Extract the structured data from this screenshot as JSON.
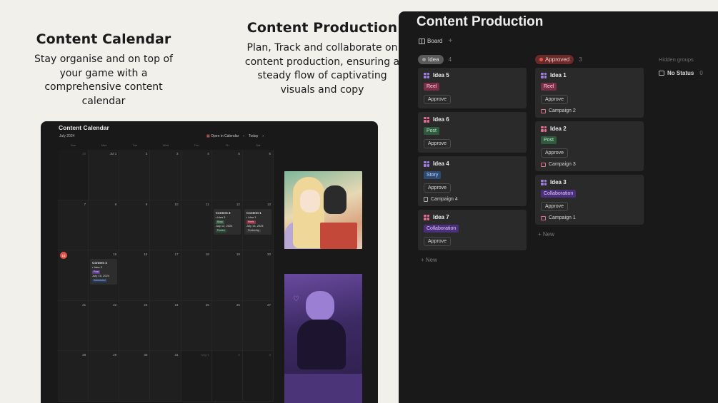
{
  "promo_calendar": {
    "title": "Content Calendar",
    "text": "Stay organise and on top of your game with a comprehensive content calendar"
  },
  "promo_production": {
    "title": "Content Production",
    "text": "Plan, Track and collaborate on content production, ensuring a steady flow of captivating visuals and copy"
  },
  "calendar": {
    "title": "Content Calendar",
    "month": "July 2024",
    "open_label": "Open in Calendar",
    "today_label": "Today",
    "weekdays": [
      "Sun",
      "Mon",
      "Tue",
      "Wed",
      "Thu",
      "Fri",
      "Sat"
    ],
    "days": [
      {
        "n": "30",
        "out": true
      },
      {
        "n": "Jul 1"
      },
      {
        "n": "2"
      },
      {
        "n": "3"
      },
      {
        "n": "4"
      },
      {
        "n": "5"
      },
      {
        "n": "6"
      },
      {
        "n": "7"
      },
      {
        "n": "8"
      },
      {
        "n": "9"
      },
      {
        "n": "10"
      },
      {
        "n": "11"
      },
      {
        "n": "12",
        "event": {
          "title": "Content 3",
          "idea": "Idea 3",
          "tag": "Story",
          "tag_class": "mt-story",
          "date": "July 12, 2024",
          "status": "Posted",
          "status_class": "green"
        }
      },
      {
        "n": "13",
        "event": {
          "title": "Content 1",
          "idea": "Idea 1",
          "tag": "Reels",
          "tag_class": "mt-reel",
          "date": "July 13, 2024",
          "status": "Producing",
          "status_class": ""
        }
      },
      {
        "n": "14",
        "today": true
      },
      {
        "n": "15",
        "event": {
          "title": "Content 2",
          "idea": "Idea 3",
          "tag": "Post",
          "tag_class": "mt-post",
          "date": "July 15, 2024",
          "status": "Scheduled",
          "status_class": "blue"
        }
      },
      {
        "n": "16"
      },
      {
        "n": "17"
      },
      {
        "n": "18"
      },
      {
        "n": "19"
      },
      {
        "n": "20"
      },
      {
        "n": "21"
      },
      {
        "n": "22"
      },
      {
        "n": "23"
      },
      {
        "n": "24"
      },
      {
        "n": "25"
      },
      {
        "n": "26"
      },
      {
        "n": "27"
      },
      {
        "n": "28"
      },
      {
        "n": "29"
      },
      {
        "n": "30"
      },
      {
        "n": "31"
      },
      {
        "n": "Aug 1",
        "out": true
      },
      {
        "n": "2",
        "out": true
      },
      {
        "n": "3",
        "out": true
      }
    ]
  },
  "board": {
    "title": "Content Production",
    "view_label": "Board",
    "add_view": "+",
    "new_label": "New",
    "hidden_groups": "Hidden groups",
    "no_status": {
      "label": "No Status",
      "count": "0"
    },
    "columns": [
      {
        "label": "Idea",
        "count": "4",
        "pill": "idea",
        "cards": [
          {
            "name": "Idea 5",
            "icon": "gi-purple",
            "tag": "Reel",
            "tag_class": "t-reel",
            "action": "Approve",
            "campaign": ""
          },
          {
            "name": "Idea 6",
            "icon": "gi-pink",
            "tag": "Post",
            "tag_class": "t-post",
            "action": "Approve",
            "campaign": ""
          },
          {
            "name": "Idea 4",
            "icon": "gi-purple",
            "tag": "Story",
            "tag_class": "t-story",
            "action": "Approve",
            "campaign": "Campaign 4",
            "campaign_icon": "doc-icon"
          },
          {
            "name": "Idea 7",
            "icon": "gi-pink",
            "tag": "Collaboration",
            "tag_class": "t-collab",
            "action": "Approve",
            "campaign": ""
          }
        ]
      },
      {
        "label": "Approved",
        "count": "3",
        "pill": "approved",
        "cards": [
          {
            "name": "Idea 1",
            "icon": "gi-purple",
            "tag": "Reel",
            "tag_class": "t-reel",
            "action": "Approve",
            "campaign": "Campaign 2",
            "campaign_icon": "camp-icon"
          },
          {
            "name": "Idea 2",
            "icon": "gi-pink",
            "tag": "Post",
            "tag_class": "t-post",
            "action": "Approve",
            "campaign": "Campaign 3",
            "campaign_icon": "camp-icon"
          },
          {
            "name": "Idea 3",
            "icon": "gi-purple",
            "tag": "Collaboration",
            "tag_class": "t-collab",
            "action": "Approve",
            "campaign": "Campaign 1",
            "campaign_icon": "camp-icon"
          }
        ]
      }
    ]
  }
}
